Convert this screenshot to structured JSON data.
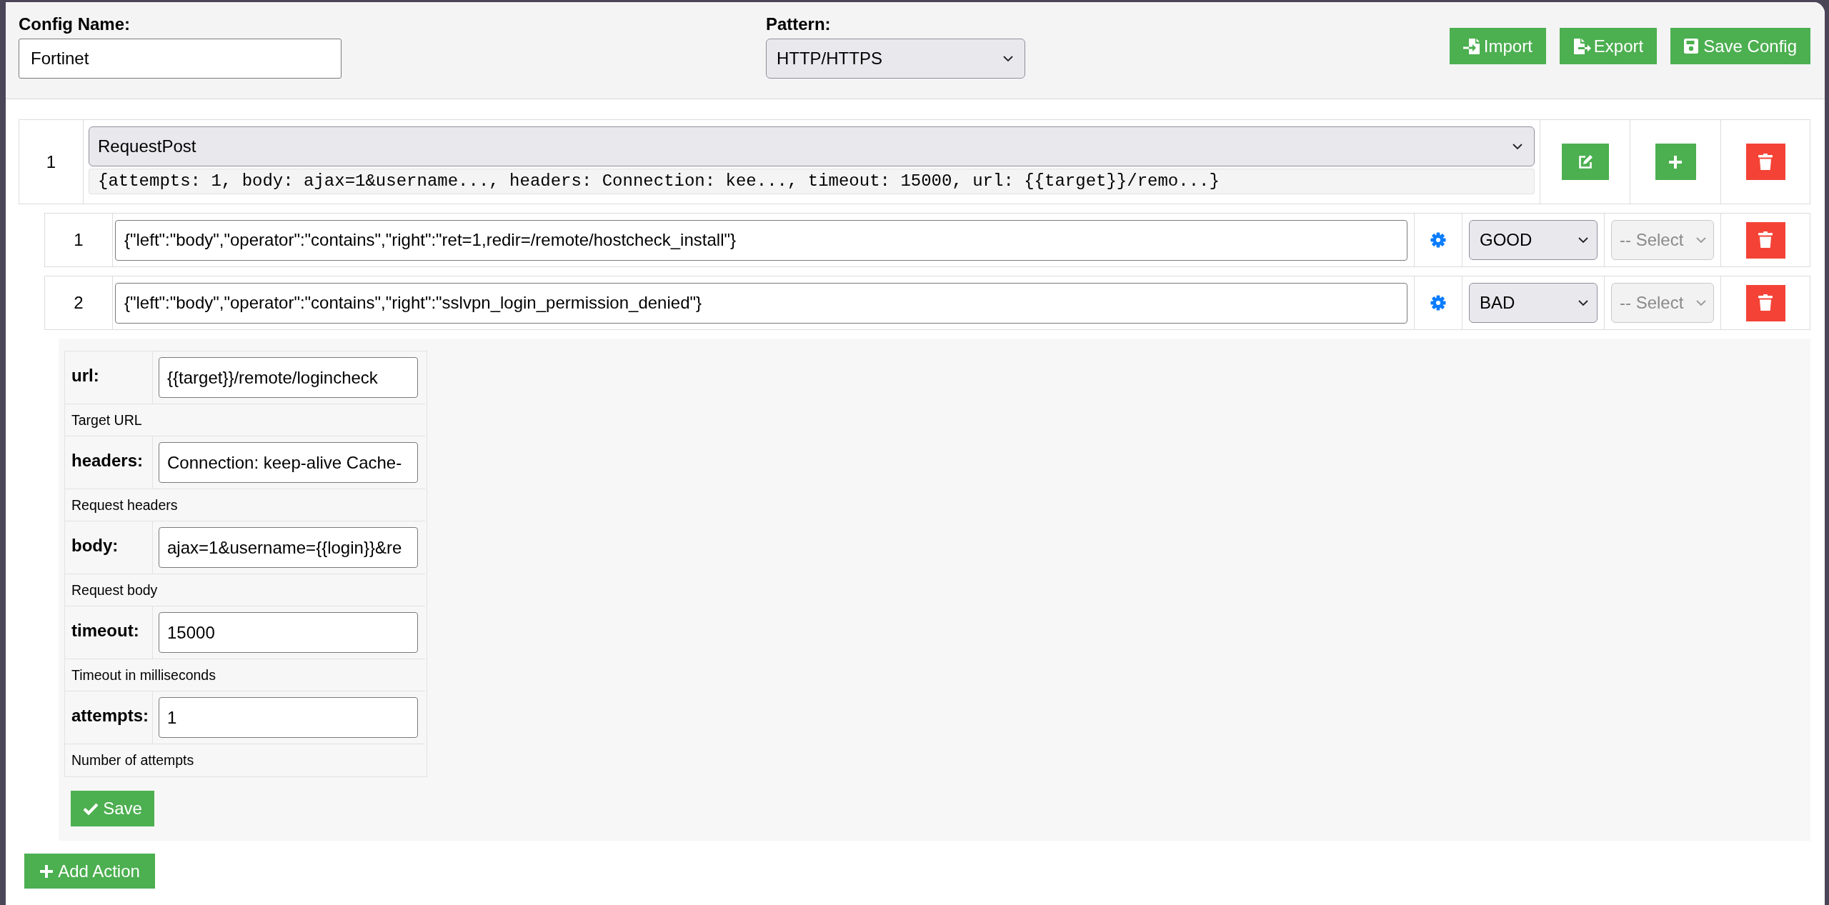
{
  "header": {
    "config_name": {
      "label": "Config Name:",
      "value": "Fortinet"
    },
    "pattern": {
      "label": "Pattern:",
      "value": "HTTP/HTTPS"
    },
    "buttons": [
      {
        "label": "Import",
        "kind": "import"
      },
      {
        "label": "Export",
        "kind": "export"
      },
      {
        "label": "Save Config",
        "kind": "save"
      }
    ]
  },
  "actions": [
    {
      "number": "1",
      "type": "RequestPost",
      "summary": "{attempts: 1, body: ajax=1&username..., headers: Connection: kee..., timeout: 15000, url: {{target}}/remo...}",
      "conditions": [
        {
          "number": "1",
          "expression": "{\"left\":\"body\",\"operator\":\"contains\",\"right\":\"ret=1,redir=/remote/hostcheck_install\"}",
          "result": "GOOD",
          "next": {
            "value": "-- Select",
            "disabled": true
          }
        },
        {
          "number": "2",
          "expression": "{\"left\":\"body\",\"operator\":\"contains\",\"right\":\"sslvpn_login_permission_denied\"}",
          "result": "BAD",
          "next": {
            "value": "-- Select",
            "disabled": true
          }
        }
      ],
      "editor": {
        "fields": [
          {
            "label": "url:",
            "value": "{{target}}/remote/logincheck",
            "description": "Target URL"
          },
          {
            "label": "headers:",
            "value": "Connection: keep-alive Cache-",
            "description": "Request headers"
          },
          {
            "label": "body:",
            "value": "ajax=1&username={{login}}&re",
            "description": "Request body"
          },
          {
            "label": "timeout:",
            "value": "15000",
            "description": "Timeout in milliseconds"
          },
          {
            "label": "attempts:",
            "value": "1",
            "description": "Number of attempts"
          }
        ],
        "save_label": "Save"
      }
    }
  ],
  "add_action_label": "Add Action"
}
